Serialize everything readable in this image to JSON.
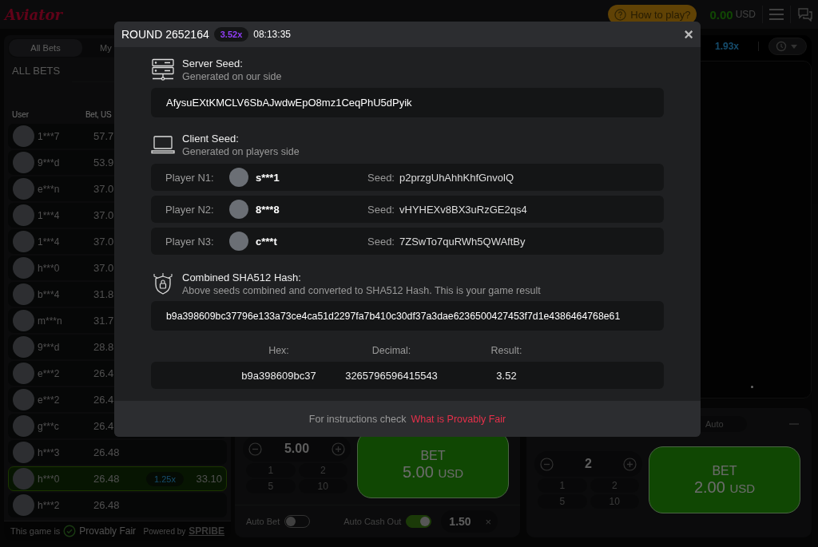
{
  "header": {
    "logo": "Aviator",
    "how_to_play": "How to play?",
    "balance": "0.00",
    "currency": "USD"
  },
  "bets_panel": {
    "tabs": [
      {
        "label": "All Bets",
        "selected": true
      },
      {
        "label": "My",
        "selected": false
      }
    ],
    "title": "ALL BETS",
    "columns": [
      "User",
      "Bet, US"
    ],
    "rows": [
      {
        "user": "1***7",
        "bet": "57.7",
        "won": false
      },
      {
        "user": "9***d",
        "bet": "53.9",
        "won": false
      },
      {
        "user": "e***n",
        "bet": "37.0",
        "won": false
      },
      {
        "user": "1***4",
        "bet": "37.0",
        "won": false
      },
      {
        "user": "1***4",
        "bet": "37.0",
        "won": false
      },
      {
        "user": "h***0",
        "bet": "37.0",
        "won": false
      },
      {
        "user": "b***4",
        "bet": "31.8",
        "won": false
      },
      {
        "user": "m***n",
        "bet": "31.7",
        "won": false
      },
      {
        "user": "9***d",
        "bet": "28.8",
        "won": false
      },
      {
        "user": "e***2",
        "bet": "26.4",
        "won": false
      },
      {
        "user": "e***2",
        "bet": "26.4",
        "won": false
      },
      {
        "user": "g***c",
        "bet": "26.4",
        "won": false
      },
      {
        "user": "h***3",
        "bet": "26.48",
        "won": false
      },
      {
        "user": "h***0",
        "bet": "26.48",
        "won": true,
        "multiplier": "1.25x",
        "win": "33.10"
      },
      {
        "user": "h***2",
        "bet": "26.48",
        "won": false
      }
    ],
    "footer": {
      "text": "This game is",
      "fair": "Provably Fair",
      "powered": "Powered by",
      "brand": "SPRIBE"
    }
  },
  "game": {
    "history": [
      "1.93x"
    ]
  },
  "bet_panels": [
    {
      "amount": "5.00",
      "quick": [
        "1",
        "2",
        "5",
        "10"
      ],
      "bet_label": "BET",
      "bet_amount": "5.00",
      "currency": "USD",
      "auto_bet": {
        "label": "Auto Bet",
        "on": false
      },
      "auto_cash_out": {
        "label": "Auto Cash Out",
        "on": true,
        "value": "1.50",
        "clear": "×"
      }
    },
    {
      "tab": "Auto",
      "amount": "2",
      "quick": [
        "1",
        "2",
        "5",
        "10"
      ],
      "bet_label": "BET",
      "bet_amount": "2.00",
      "currency": "USD"
    }
  ],
  "modal": {
    "round": "ROUND 2652164",
    "multiplier": "3.52x",
    "time": "08:13:35",
    "close": "×",
    "server_seed": {
      "title": "Server Seed:",
      "subtitle": "Generated on our side",
      "value": "AfysuEXtKMCLV6SbAJwdwEpO8mz1CeqPhU5dPyik"
    },
    "client_seed": {
      "title": "Client Seed:",
      "subtitle": "Generated on players side",
      "players": [
        {
          "label": "Player N1:",
          "name": "s***1",
          "seed_label": "Seed:",
          "seed": "p2przgUhAhhKhfGnvolQ"
        },
        {
          "label": "Player N2:",
          "name": "8***8",
          "seed_label": "Seed:",
          "seed": "vHYHEXv8BX3uRzGE2qs4"
        },
        {
          "label": "Player N3:",
          "name": "c***t",
          "seed_label": "Seed:",
          "seed": "7ZSwTo7quRWh5QWAftBy"
        }
      ]
    },
    "hash": {
      "title": "Combined SHA512 Hash:",
      "subtitle": "Above seeds combined and converted to SHA512 Hash. This is your game result",
      "value": "b9a398609bc37796e133a73ce4ca51d2297fa7b410c30df37a3dae6236500427453f7d1e4386464768e61"
    },
    "result": {
      "labels": [
        "Hex:",
        "Decimal:",
        "Result:"
      ],
      "values": [
        "b9a398609bc37",
        "3265796596415543",
        "3.52"
      ]
    },
    "footer": {
      "text": "For instructions check",
      "link": "What is Provably Fair"
    }
  }
}
